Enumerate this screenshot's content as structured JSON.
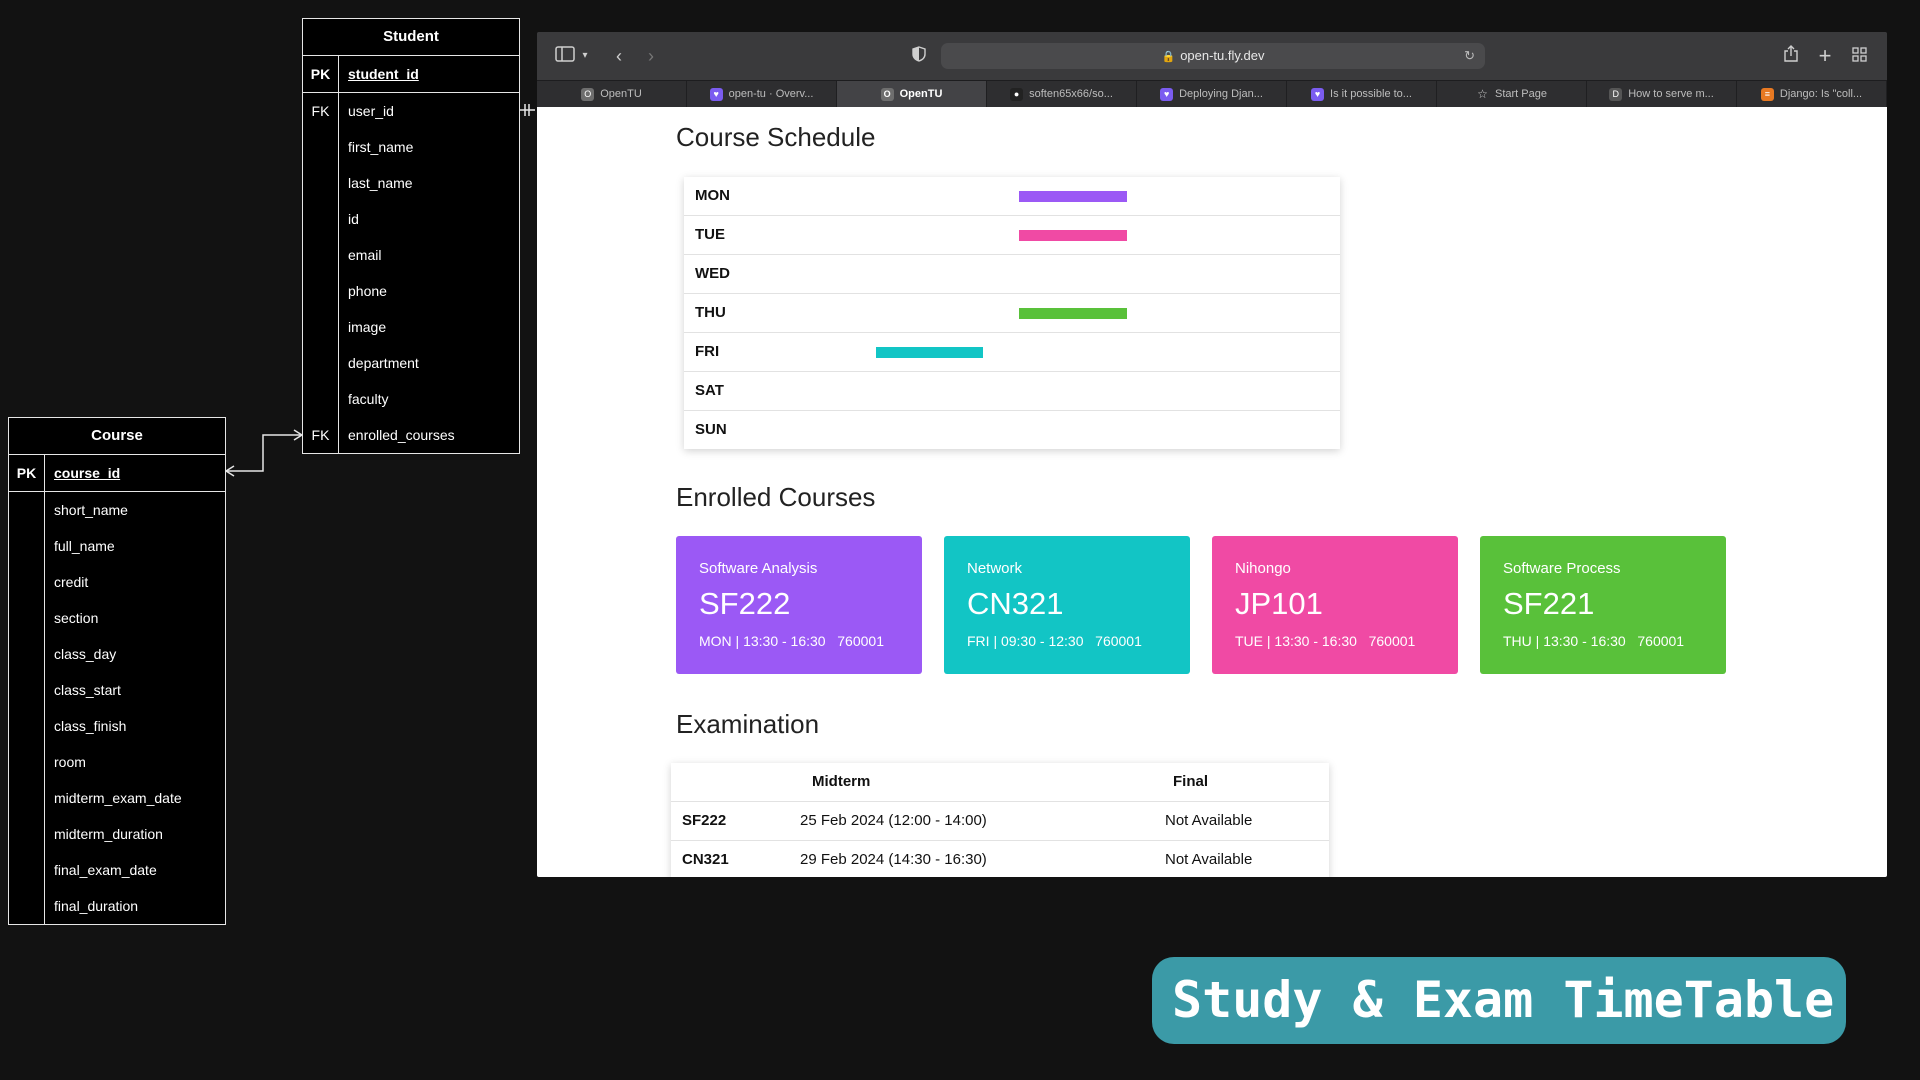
{
  "er_diagram": {
    "student": {
      "title": "Student",
      "pk": {
        "key": "PK",
        "field": "student_id"
      },
      "fields": [
        {
          "key": "FK",
          "field": "user_id"
        },
        {
          "key": "",
          "field": "first_name"
        },
        {
          "key": "",
          "field": "last_name"
        },
        {
          "key": "",
          "field": "id"
        },
        {
          "key": "",
          "field": "email"
        },
        {
          "key": "",
          "field": "phone"
        },
        {
          "key": "",
          "field": "image"
        },
        {
          "key": "",
          "field": "department"
        },
        {
          "key": "",
          "field": "faculty"
        },
        {
          "key": "FK",
          "field": "enrolled_courses"
        }
      ]
    },
    "course": {
      "title": "Course",
      "pk": {
        "key": "PK",
        "field": "course_id"
      },
      "fields": [
        {
          "key": "",
          "field": "short_name"
        },
        {
          "key": "",
          "field": "full_name"
        },
        {
          "key": "",
          "field": "credit"
        },
        {
          "key": "",
          "field": "section"
        },
        {
          "key": "",
          "field": "class_day"
        },
        {
          "key": "",
          "field": "class_start"
        },
        {
          "key": "",
          "field": "class_finish"
        },
        {
          "key": "",
          "field": "room"
        },
        {
          "key": "",
          "field": "midterm_exam_date"
        },
        {
          "key": "",
          "field": "midterm_duration"
        },
        {
          "key": "",
          "field": "final_exam_date"
        },
        {
          "key": "",
          "field": "final_duration"
        }
      ]
    }
  },
  "browser": {
    "url": "open-tu.fly.dev",
    "tabs": [
      {
        "label": "OpenTU",
        "icon": "opentu-icon",
        "active": false
      },
      {
        "label": "open-tu · Overv...",
        "icon": "flyio-icon",
        "active": false
      },
      {
        "label": "OpenTU",
        "icon": "opentu-icon",
        "active": true
      },
      {
        "label": "soften65x66/so...",
        "icon": "github-icon",
        "active": false
      },
      {
        "label": "Deploying Djan...",
        "icon": "flyio-icon",
        "active": false
      },
      {
        "label": "Is it possible to...",
        "icon": "flyio-icon",
        "active": false
      },
      {
        "label": "Start Page",
        "icon": "star-icon",
        "active": false
      },
      {
        "label": "How to serve m...",
        "icon": "doc-icon",
        "active": false
      },
      {
        "label": "Django: Is \"coll...",
        "icon": "stackoverflow-icon",
        "active": false
      }
    ]
  },
  "page": {
    "schedule_title": "Course Schedule",
    "schedule": [
      {
        "day": "MON",
        "color": "#9b59f5",
        "start": 13.5,
        "end": 16.5
      },
      {
        "day": "TUE",
        "color": "#f04aa4",
        "start": 13.5,
        "end": 16.5
      },
      {
        "day": "WED"
      },
      {
        "day": "THU",
        "color": "#59c13a",
        "start": 13.5,
        "end": 16.5
      },
      {
        "day": "FRI",
        "color": "#12c5c5",
        "start": 9.5,
        "end": 12.5
      },
      {
        "day": "SAT"
      },
      {
        "day": "SUN"
      }
    ],
    "enrolled_title": "Enrolled Courses",
    "courses": [
      {
        "name": "Software Analysis",
        "code": "SF222",
        "time": "MON | 13:30 - 16:30",
        "section": "760001",
        "color": "#9b59f5"
      },
      {
        "name": "Network",
        "code": "CN321",
        "time": "FRI | 09:30 - 12:30",
        "section": "760001",
        "color": "#12c5c5"
      },
      {
        "name": "Nihongo",
        "code": "JP101",
        "time": "TUE | 13:30 - 16:30",
        "section": "760001",
        "color": "#f04aa4"
      },
      {
        "name": "Software Process",
        "code": "SF221",
        "time": "THU | 13:30 - 16:30",
        "section": "760001",
        "color": "#59c13a"
      }
    ],
    "exam_title": "Examination",
    "exam_headers": {
      "midterm": "Midterm",
      "final": "Final"
    },
    "exams": [
      {
        "code": "SF222",
        "midterm": "25 Feb 2024 (12:00 - 14:00)",
        "final": "Not Available"
      },
      {
        "code": "CN321",
        "midterm": "29 Feb 2024 (14:30 - 16:30)",
        "final": "Not Available"
      }
    ]
  },
  "banner": {
    "text": "Study & Exam TimeTable"
  }
}
